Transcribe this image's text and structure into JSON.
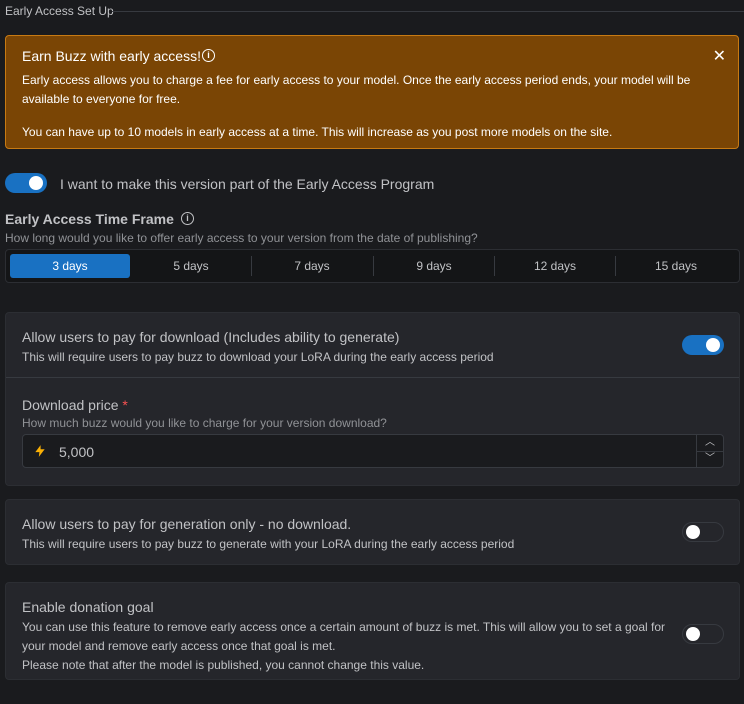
{
  "section": {
    "legend": "Early Access Set Up"
  },
  "alert": {
    "title": "Earn Buzz with early access!",
    "paragraph1": "Early access allows you to charge a fee for early access to your model. Once the early access period ends, your model will be available to everyone for free.",
    "paragraph2": "You can have up to 10 models in early access at a time. This will increase as you post more models on the site.",
    "close_glyph": "✕"
  },
  "early_access": {
    "enabled": true,
    "label": "I want to make this version part of the Early Access Program"
  },
  "time_frame": {
    "title": "Early Access Time Frame",
    "description": "How long would you like to offer early access to your version from the date of publishing?",
    "options": [
      "3 days",
      "5 days",
      "7 days",
      "9 days",
      "12 days",
      "15 days"
    ],
    "selected": "3 days"
  },
  "download": {
    "title": "Allow users to pay for download (Includes ability to generate)",
    "description": "This will require users to pay buzz to download your LoRA during the early access period",
    "enabled": true,
    "price_label": "Download price",
    "required_mark": "*",
    "price_description": "How much buzz would you like to charge for your version download?",
    "price_value": "5,000"
  },
  "generation": {
    "title": "Allow users to pay for generation only - no download.",
    "description": "This will require users to pay buzz to generate with your LoRA during the early access period",
    "enabled": false
  },
  "donation": {
    "title": "Enable donation goal",
    "description_line1": "You can use this feature to remove early access once a certain amount of buzz is met. This will allow you to set a goal for",
    "description_line2": "your model and remove early access once that goal is met.",
    "description_line3": "Please note that after the model is published, you cannot change this value.",
    "enabled": false
  },
  "icons": {
    "info": "info-icon",
    "close": "close-icon",
    "bolt": "lightning-bolt-icon",
    "up": "chevron-up-icon",
    "down": "chevron-down-icon"
  },
  "colors": {
    "accent": "#1971c2",
    "alert_bg": "#7a4505",
    "alert_border": "#c77a13",
    "bolt": "#fab005",
    "required": "#fa5252"
  }
}
